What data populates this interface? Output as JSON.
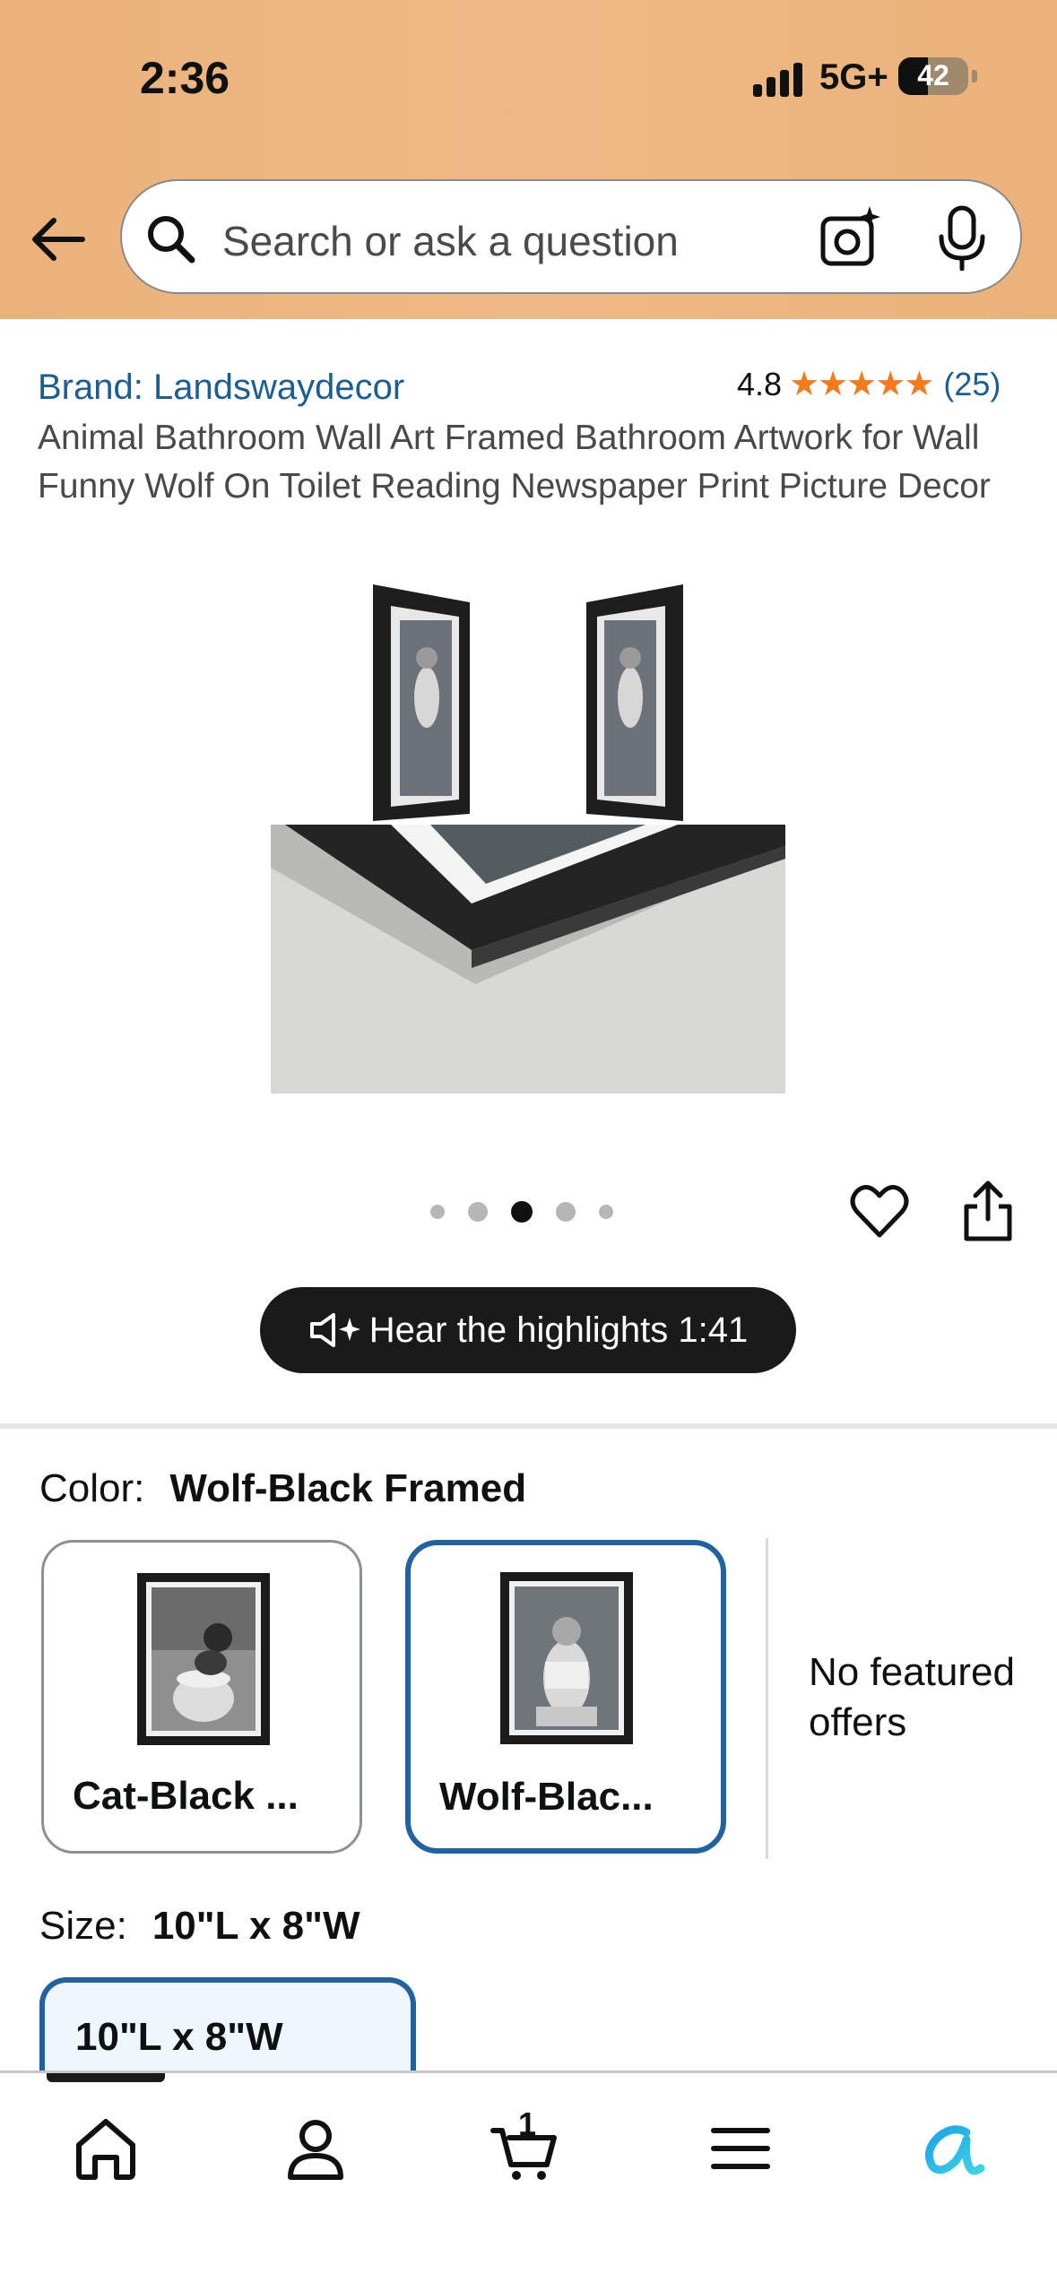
{
  "status_bar": {
    "time": "2:36",
    "network": "5G+",
    "battery": "42",
    "battery_level": 0.42
  },
  "header": {
    "search_placeholder": "Search or ask a question"
  },
  "product": {
    "brand": "Brand: Landswaydecor",
    "rating": "4.8",
    "stars": "★★★★★",
    "review_count": "(25)",
    "title": "Animal Bathroom Wall Art Framed Bathroom Artwork for Wall Funny Wolf On Toilet Reading Newspaper Print Picture Decor"
  },
  "gallery": {
    "image_count": 5,
    "active_index": 2
  },
  "audio": {
    "label": "Hear the highlights 1:41"
  },
  "color": {
    "label": "Color:",
    "selected": "Wolf-Black Framed",
    "options": [
      {
        "label": "Cat-Black ..."
      },
      {
        "label": "Wolf-Blac..."
      }
    ],
    "offers_text": "No featured offers"
  },
  "size": {
    "label": "Size:",
    "selected": "10\"L x 8\"W",
    "option_label": "10\"L x 8\"W"
  },
  "bottom_nav": {
    "cart_count": "1",
    "items": [
      "home-icon",
      "account-icon",
      "cart-icon",
      "menu-icon",
      "rufus-icon"
    ]
  },
  "colors": {
    "header_bg": "#ebb27a",
    "link": "#1b5e94",
    "star": "#f47a1b",
    "selected_border": "#2162a1"
  }
}
